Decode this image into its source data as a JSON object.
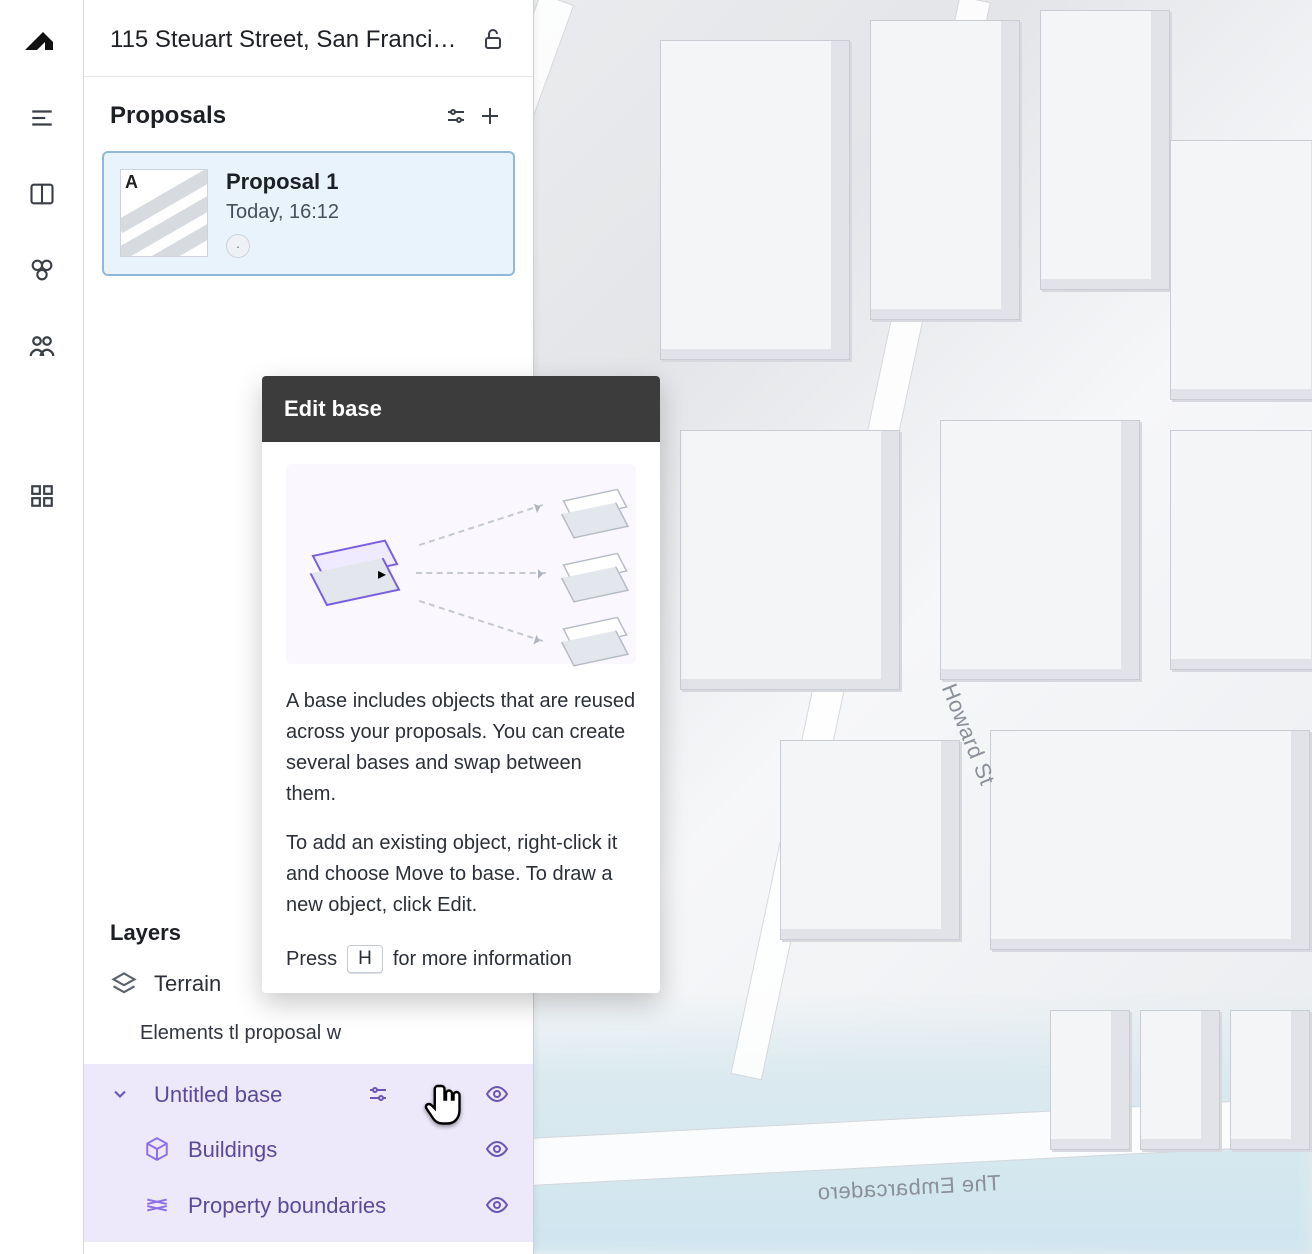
{
  "header": {
    "address": "115 Steuart Street, San Francisco, …"
  },
  "proposals": {
    "title": "Proposals",
    "items": [
      {
        "label": "Proposal 1",
        "time": "Today, 16:12",
        "thumb_tag": "A"
      }
    ]
  },
  "layers": {
    "title": "Layers",
    "terrain": "Terrain",
    "hint": "Elements tl proposal w",
    "base_name": "Untitled base",
    "buildings": "Buildings",
    "boundaries": "Property boundaries"
  },
  "popover": {
    "title": "Edit base",
    "p1": "A base includes objects that are reused across your proposals. You can create several bases and swap between them.",
    "p2": "To add an existing object, right-click it and choose Move to base. To draw a new object, click Edit.",
    "key_prefix": "Press",
    "key": "H",
    "key_suffix": "for more information"
  },
  "map": {
    "street1": "The Embarcadero",
    "street2": "Howard St"
  }
}
